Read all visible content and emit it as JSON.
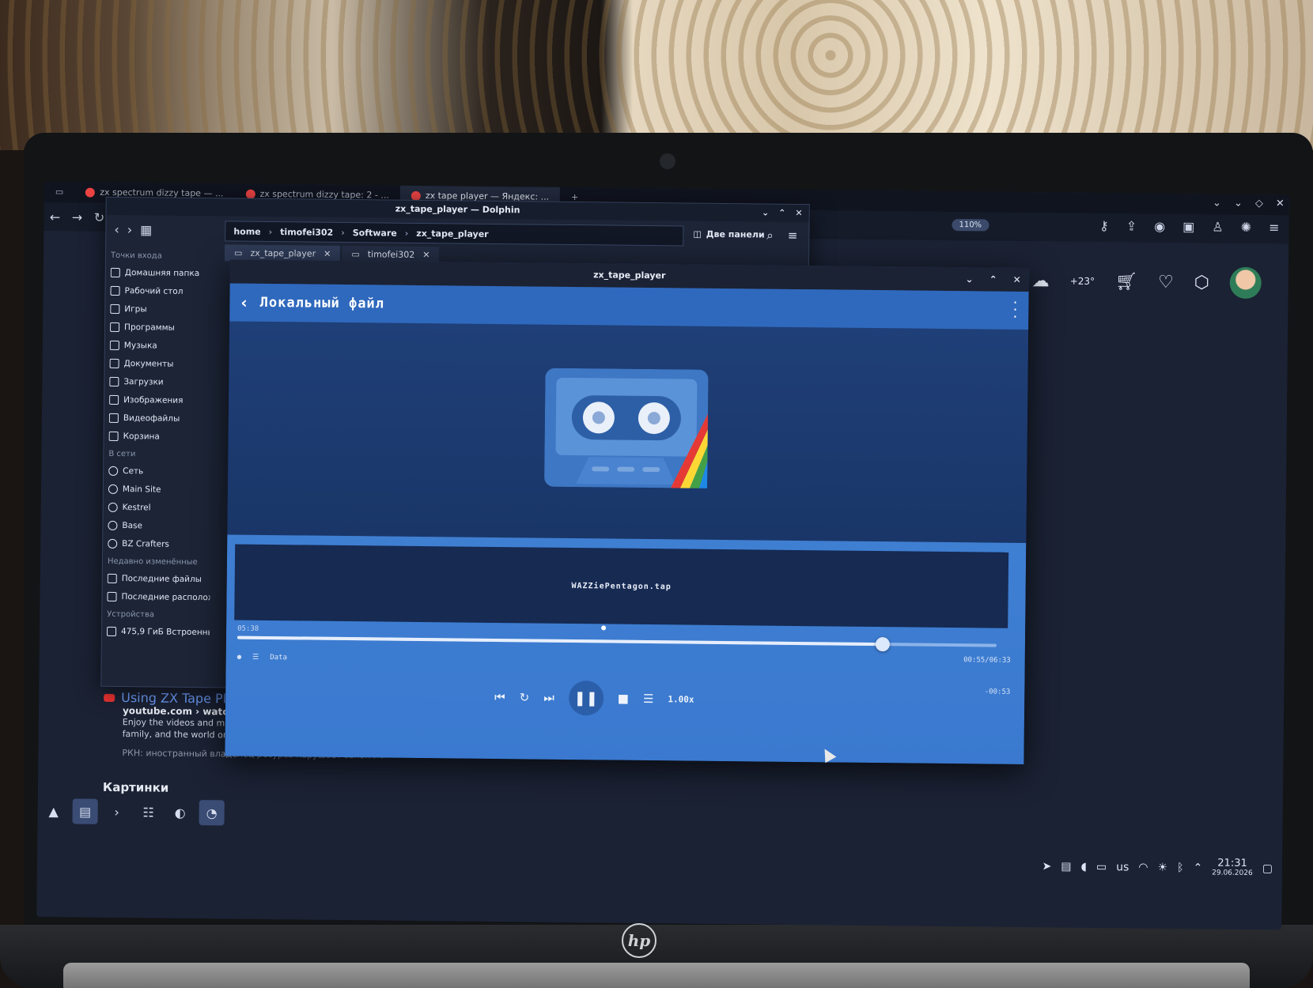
{
  "browser": {
    "tabs": [
      {
        "label": "zx spectrum dizzy tape — ..."
      },
      {
        "label": "zx spectrum dizzy tape: 2 - ..."
      },
      {
        "label": "zx tape player — Яндекс: ..."
      }
    ],
    "zoom": "110%"
  },
  "shop": {
    "temperature": "+23°"
  },
  "search_result": {
    "title": "Using ZX Tape Play",
    "source": "youtube.com › watch",
    "description": "Enjoy the videos and music you love, upload original content, and share it all with friends, family, and the world on YouTube.",
    "notice": "РКН: иностранный владелец ресурса нарушает закон РФ",
    "images_heading": "Картинки"
  },
  "dolphin": {
    "title": "zx_tape_player — Dolphin",
    "breadcrumbs": [
      "home",
      "timofei302",
      "Software",
      "zx_tape_player"
    ],
    "two_panes_label": "Две панели",
    "tabs": [
      {
        "label": "zx_tape_player"
      },
      {
        "label": "timofei302"
      }
    ],
    "sidebar": {
      "places_heading": "Точки входа",
      "places": [
        {
          "label": "Домашняя папка",
          "icon": "home-icon"
        },
        {
          "label": "Рабочий стол",
          "icon": "desktop-icon"
        },
        {
          "label": "Игры",
          "icon": "gamepad-icon"
        },
        {
          "label": "Программы",
          "icon": "apps-icon"
        },
        {
          "label": "Музыка",
          "icon": "music-icon"
        },
        {
          "label": "Документы",
          "icon": "documents-icon"
        },
        {
          "label": "Загрузки",
          "icon": "downloads-icon"
        },
        {
          "label": "Изображения",
          "icon": "images-icon"
        },
        {
          "label": "Видеофайлы",
          "icon": "video-icon"
        },
        {
          "label": "Корзина",
          "icon": "trash-icon"
        }
      ],
      "network_heading": "В сети",
      "network": [
        {
          "label": "Сеть",
          "icon": "network-icon"
        },
        {
          "label": "Main Site",
          "icon": "globe-icon"
        },
        {
          "label": "Kestrel",
          "icon": "globe-icon"
        },
        {
          "label": "Base",
          "icon": "globe-icon"
        },
        {
          "label": "BZ Crafters",
          "icon": "globe-icon"
        }
      ],
      "recent_heading": "Недавно изменённые",
      "recent": [
        {
          "label": "Последние файлы",
          "icon": "recent-files-icon"
        },
        {
          "label": "Последние расположен...",
          "icon": "recent-locations-icon"
        }
      ],
      "devices_heading": "Устройства",
      "devices": [
        {
          "label": "475,9 ГиБ Встроенный ...",
          "icon": "drive-icon"
        }
      ]
    }
  },
  "player": {
    "window_title": "zx_tape_player",
    "heading": "Локальный файл",
    "filename": "WAZZiePentagon.tap",
    "elapsed": "05:38",
    "position": "00:55/06:33",
    "remaining": "-00:53",
    "progress": 0.85,
    "block_label": "Data",
    "speed": "1.00x"
  },
  "tray": {
    "layout": "us",
    "time": "21:31",
    "date": "29.06.2026"
  }
}
